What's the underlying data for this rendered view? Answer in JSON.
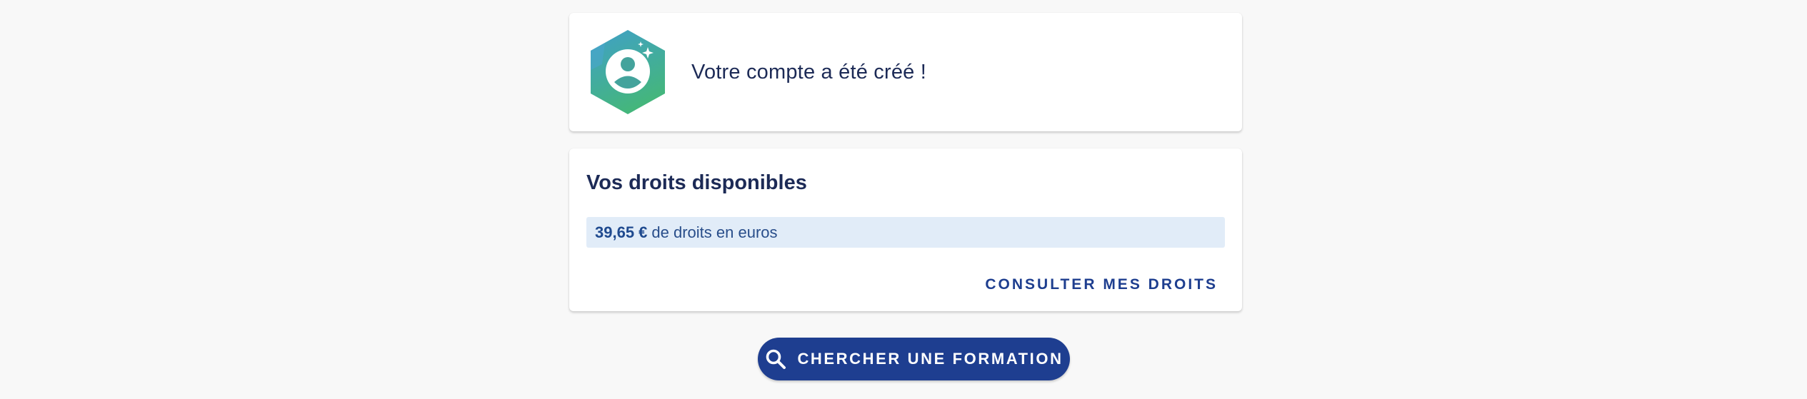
{
  "success": {
    "message": "Votre compte a été créé !",
    "icon": "user-account-created-icon"
  },
  "rights": {
    "title": "Vos droits disponibles",
    "amount": "39,65 €",
    "amount_suffix": "de droits en euros",
    "consult_label": "CONSULTER MES DROITS"
  },
  "search": {
    "label": "CHERCHER UNE FORMATION",
    "icon": "search-icon"
  },
  "colors": {
    "background": "#f8f8f8",
    "text_primary": "#1c2a56",
    "accent_blue": "#1e3e90",
    "highlight_bg": "#e1ecf8",
    "badge_gradient_start": "#3f9ec4",
    "badge_gradient_end": "#42b67f"
  }
}
